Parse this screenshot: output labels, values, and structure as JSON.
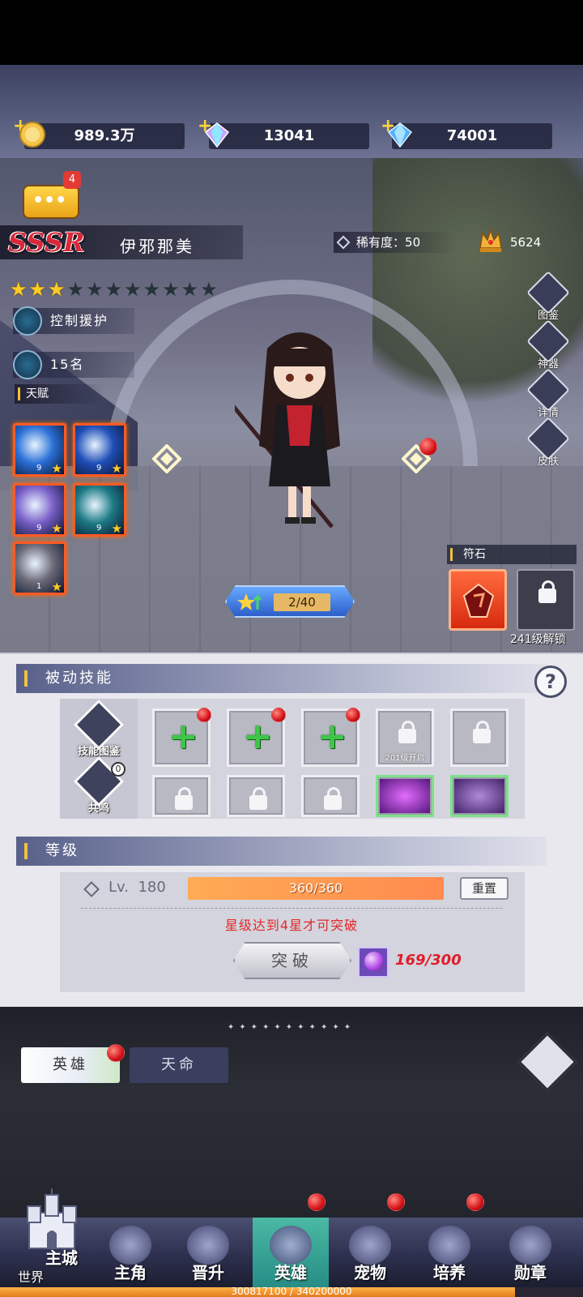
{
  "currencies": [
    {
      "name": "gold",
      "value": "989.3万",
      "icon": "gold-coin-icon"
    },
    {
      "name": "crystal",
      "value": "13041",
      "icon": "rainbow-crystal-icon"
    },
    {
      "name": "diamond",
      "value": "74001",
      "icon": "blue-diamond-icon"
    }
  ],
  "chat": {
    "badge": "4"
  },
  "hero": {
    "rarity": "SSSR",
    "name": "伊邪那美",
    "rarity_label": "稀有度",
    "rarity_separator": "：",
    "rarity_value": "50",
    "power": "5624",
    "stars_filled": 3,
    "stars_total": 11,
    "role": "控制援护",
    "rank": "15名"
  },
  "talent": {
    "label": "天赋",
    "skills": [
      {
        "level": "9",
        "color": "#2a6fd6"
      },
      {
        "level": "9",
        "color": "#1f4fb8"
      },
      {
        "level": "9",
        "color": "#7a5fc8"
      },
      {
        "level": "9",
        "color": "#1c7a84"
      },
      {
        "level": "1",
        "color": "#6c6a78"
      }
    ]
  },
  "side_buttons": [
    "图鉴",
    "神器",
    "详情",
    "皮肤"
  ],
  "exp": {
    "value": "2/40"
  },
  "rune": {
    "label": "符石",
    "unlock_text": "241级解锁"
  },
  "passive": {
    "title": "被动技能",
    "help": "?",
    "side": [
      {
        "label": "技能图鉴"
      },
      {
        "label": "共鸣",
        "badge": "0"
      }
    ],
    "slot_note": "201级开启"
  },
  "level": {
    "title": "等级",
    "lv_label": "Lv.",
    "lv_value": "180",
    "bar_text": "360/360",
    "bar_fraction": 1.0,
    "reset": "重置",
    "requirement": "星级达到4星才可突破",
    "breakthrough": "突破",
    "orb_count": "169/300"
  },
  "tabs": {
    "hero": "英雄",
    "fate": "天命"
  },
  "nav": {
    "castle_title": "主城",
    "castle_sub": "世界",
    "items": [
      "主角",
      "晋升",
      "英雄",
      "宠物",
      "培养",
      "勋章"
    ]
  },
  "expbar": {
    "text": "300817100 / 340200000",
    "fraction": 0.884
  }
}
